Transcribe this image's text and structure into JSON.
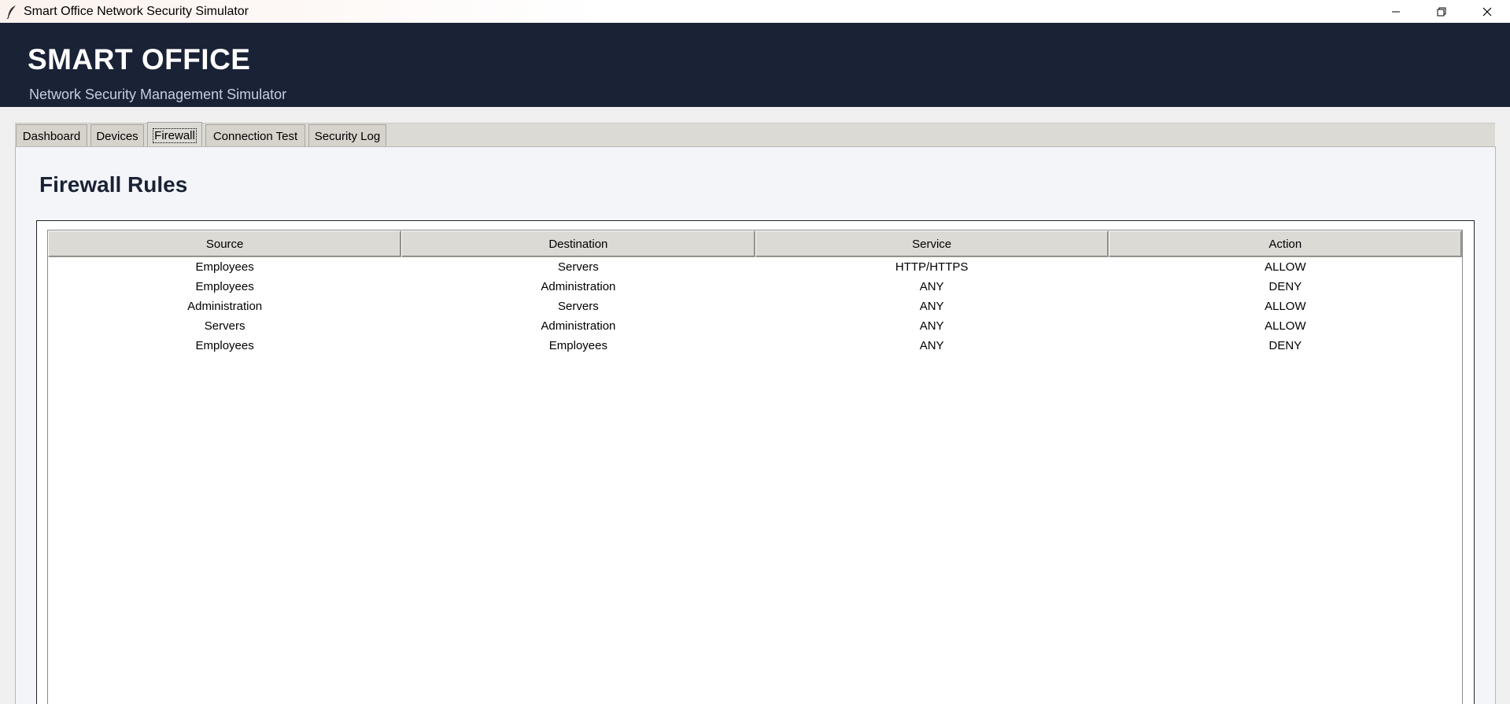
{
  "window": {
    "title": "Smart Office Network Security Simulator"
  },
  "banner": {
    "title": "SMART OFFICE",
    "subtitle": "Network Security Management Simulator"
  },
  "tabs": [
    {
      "label": "Dashboard"
    },
    {
      "label": "Devices"
    },
    {
      "label": "Firewall"
    },
    {
      "label": "Connection Test"
    },
    {
      "label": "Security Log"
    }
  ],
  "active_tab": "Firewall",
  "firewall": {
    "heading": "Firewall Rules",
    "columns": [
      "Source",
      "Destination",
      "Service",
      "Action"
    ],
    "rows": [
      [
        "Employees",
        "Servers",
        "HTTP/HTTPS",
        "ALLOW"
      ],
      [
        "Employees",
        "Administration",
        "ANY",
        "DENY"
      ],
      [
        "Administration",
        "Servers",
        "ANY",
        "ALLOW"
      ],
      [
        "Servers",
        "Administration",
        "ANY",
        "ALLOW"
      ],
      [
        "Employees",
        "Employees",
        "ANY",
        "DENY"
      ]
    ]
  },
  "colors": {
    "banner_bg": "#1a2236",
    "heading": "#1a2236"
  },
  "icons": {
    "app": "feather-icon",
    "minimize": "minimize-icon",
    "restore": "restore-icon",
    "close": "close-icon"
  }
}
